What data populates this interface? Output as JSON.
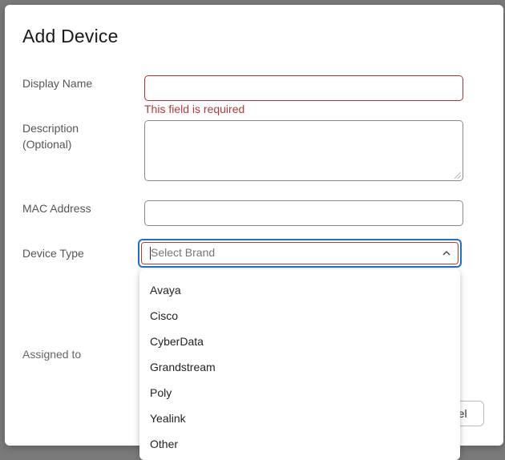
{
  "dialog": {
    "title": "Add Device"
  },
  "form": {
    "display_name": {
      "label": "Display Name",
      "value": "",
      "error": "This field is required"
    },
    "description": {
      "label_line1": "Description",
      "label_line2": "(Optional)",
      "value": ""
    },
    "mac_address": {
      "label": "MAC Address",
      "value": ""
    },
    "device_type": {
      "label": "Device Type",
      "placeholder": "Select Brand",
      "expanded": true
    },
    "assigned_to": {
      "label": "Assigned to"
    }
  },
  "dropdown": {
    "options": [
      "Avaya",
      "Cisco",
      "CyberData",
      "Grandstream",
      "Poly",
      "Yealink",
      "Other"
    ]
  },
  "footer": {
    "cancel_label": "Cancel"
  },
  "colors": {
    "error": "#b33a3a",
    "focus": "#1f6fcf"
  }
}
